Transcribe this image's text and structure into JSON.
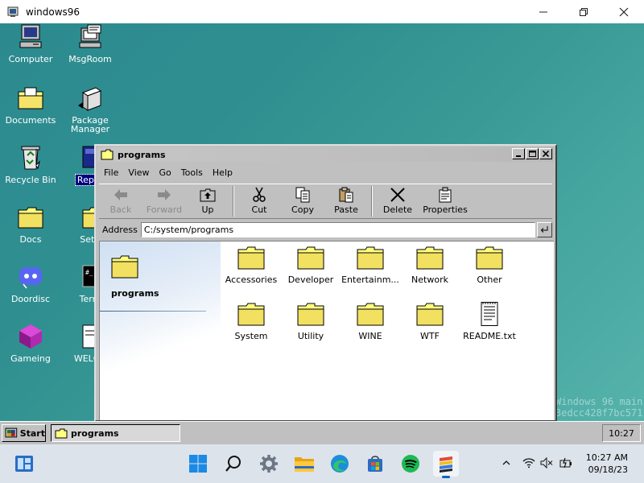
{
  "host_window": {
    "title": "windows96",
    "controls": [
      "minimize",
      "maximize",
      "close"
    ]
  },
  "desktop": {
    "icons": [
      {
        "label": "Computer",
        "icon": "computer-icon"
      },
      {
        "label": "MsgRoom",
        "icon": "msgroom-icon"
      },
      {
        "label": "Documents",
        "icon": "documents-folder-icon"
      },
      {
        "label": "Package Manager",
        "icon": "package-manager-icon"
      },
      {
        "label": "Recycle Bin",
        "icon": "recycle-bin-icon"
      },
      {
        "label": "Repor",
        "icon": "report-icon"
      },
      {
        "label": "Docs",
        "icon": "folder-icon"
      },
      {
        "label": "Setti",
        "icon": "settings-folder-icon"
      },
      {
        "label": "Doordisc",
        "icon": "doordisc-icon"
      },
      {
        "label": "Term",
        "icon": "terminal-icon"
      },
      {
        "label": "Gameing",
        "icon": "gameing-icon"
      },
      {
        "label": "WELCO",
        "icon": "welcome-icon"
      }
    ],
    "watermark_lines": [
      "Windows 96 main",
      "3edcc428f7bc571"
    ]
  },
  "explorer": {
    "title": "programs",
    "menu": [
      "File",
      "View",
      "Go",
      "Tools",
      "Help"
    ],
    "toolbar": [
      {
        "label": "Back",
        "icon": "back-arrow-icon",
        "enabled": false
      },
      {
        "label": "Forward",
        "icon": "forward-arrow-icon",
        "enabled": false
      },
      {
        "label": "Up",
        "icon": "up-folder-icon",
        "enabled": true
      },
      {
        "label": "Cut",
        "icon": "scissors-icon",
        "enabled": true
      },
      {
        "label": "Copy",
        "icon": "copy-icon",
        "enabled": true
      },
      {
        "label": "Paste",
        "icon": "paste-icon",
        "enabled": true
      },
      {
        "label": "Delete",
        "icon": "delete-x-icon",
        "enabled": true
      },
      {
        "label": "Properties",
        "icon": "properties-icon",
        "enabled": true
      }
    ],
    "address_label": "Address",
    "address_value": "C:/system/programs",
    "sidebar_title": "programs",
    "items": [
      {
        "label": "Accessories",
        "type": "folder"
      },
      {
        "label": "Developer",
        "type": "folder"
      },
      {
        "label": "Entertainm...",
        "type": "folder"
      },
      {
        "label": "Network",
        "type": "folder"
      },
      {
        "label": "Other",
        "type": "folder"
      },
      {
        "label": "System",
        "type": "folder"
      },
      {
        "label": "Utility",
        "type": "folder"
      },
      {
        "label": "WINE",
        "type": "folder"
      },
      {
        "label": "WTF",
        "type": "folder"
      },
      {
        "label": "README.txt",
        "type": "text-file"
      }
    ]
  },
  "w96_taskbar": {
    "start_label": "Start",
    "task_label": "programs",
    "clock": "10:27"
  },
  "w11_taskbar": {
    "apps": [
      "windows-start-icon",
      "search-icon",
      "settings-gear-icon",
      "file-explorer-icon",
      "edge-icon",
      "microsoft-store-icon",
      "spotify-icon",
      "windows96-app-icon"
    ],
    "time": "10:27 AM",
    "date": "09/18/23"
  },
  "colors": {
    "desktop_teal": "#2f8f90",
    "folder_yellow": "#ffff80",
    "win96_gray": "#c0c0c0",
    "selection_navy": "#000080",
    "w11_taskbar": "#dde3ea"
  }
}
